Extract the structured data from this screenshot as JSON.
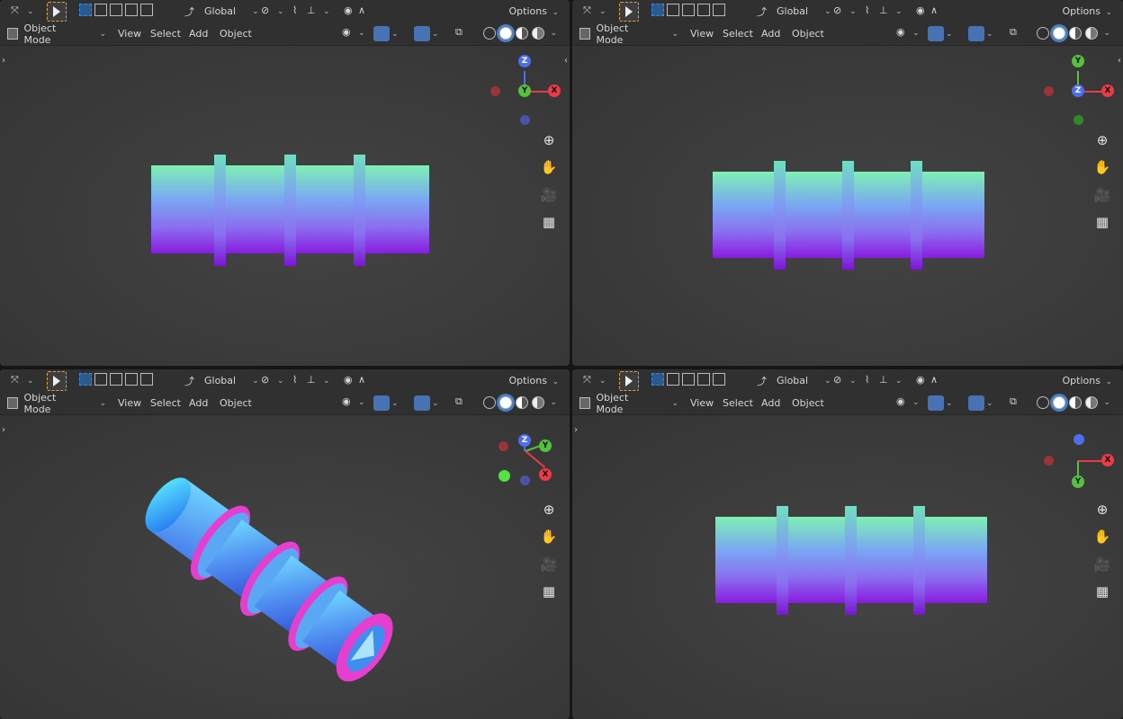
{
  "toolbar": {
    "transform_space": "Global",
    "options_label": "Options"
  },
  "header": {
    "mode": "Object Mode",
    "menus": [
      "View",
      "Select",
      "Add",
      "Object"
    ]
  },
  "colors": {
    "viewport_bg": "#3d3d3d",
    "header_bg": "#303030",
    "active_blue": "#4772b3",
    "axis_x": "#ed3b45",
    "axis_y": "#55c13c",
    "axis_z": "#4e6ef0",
    "object_top": "#7ff0b4",
    "object_bottom": "#8a1be0",
    "ring_edge": "#e63fd0"
  },
  "gizmo_labels": {
    "x": "X",
    "y": "Y",
    "z": "Z"
  },
  "icons": [
    "transform-pivot-icon",
    "select-tool-icon",
    "select-box-icon",
    "transform-orientation-icon",
    "snap-icon",
    "proportional-edit-icon",
    "visibility-icon",
    "gizmo-icon",
    "overlay-icon",
    "xray-icon",
    "wireframe-shading-icon",
    "solid-shading-icon",
    "material-shading-icon",
    "rendered-shading-icon",
    "zoom-icon",
    "pan-hand-icon",
    "camera-icon",
    "grid-icon"
  ]
}
